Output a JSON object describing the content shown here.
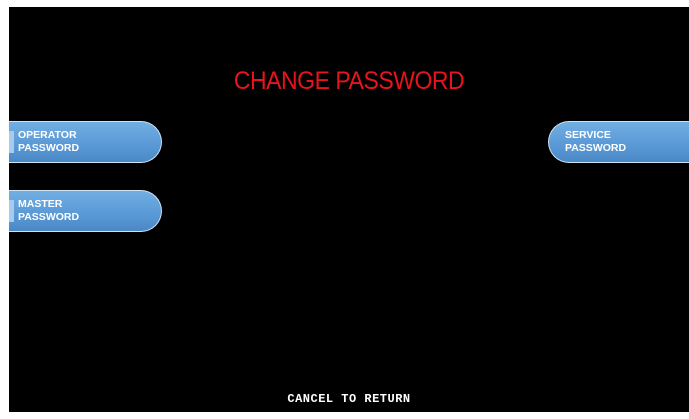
{
  "screen": {
    "title": "CHANGE PASSWORD",
    "footer": "CANCEL TO RETURN"
  },
  "left_keys": [
    {
      "line1": "OPERATOR",
      "line2": "PASSWORD"
    },
    {
      "line1": "MASTER",
      "line2": "PASSWORD"
    }
  ],
  "right_keys": [
    {
      "line1": "SERVICE",
      "line2": "PASSWORD"
    }
  ],
  "colors": {
    "background": "#000000",
    "title": "#e8141c",
    "button": "#5a9ad6",
    "button_text": "#ffffff",
    "footer_text": "#ffffff"
  }
}
